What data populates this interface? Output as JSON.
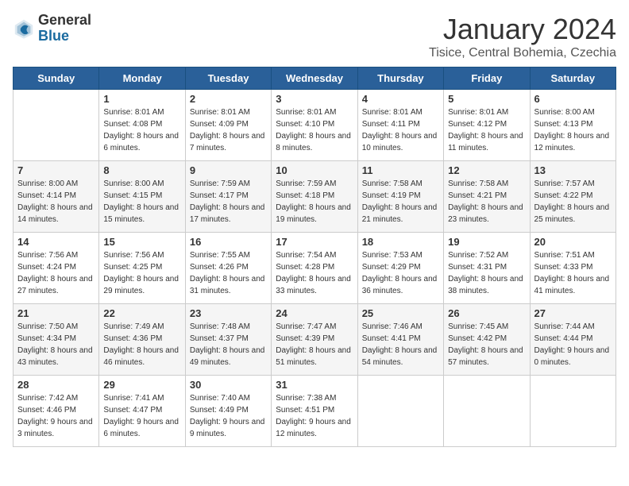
{
  "header": {
    "logo_general": "General",
    "logo_blue": "Blue",
    "month": "January 2024",
    "location": "Tisice, Central Bohemia, Czechia"
  },
  "days_of_week": [
    "Sunday",
    "Monday",
    "Tuesday",
    "Wednesday",
    "Thursday",
    "Friday",
    "Saturday"
  ],
  "weeks": [
    [
      {
        "day": "",
        "sunrise": "",
        "sunset": "",
        "daylight": ""
      },
      {
        "day": "1",
        "sunrise": "Sunrise: 8:01 AM",
        "sunset": "Sunset: 4:08 PM",
        "daylight": "Daylight: 8 hours and 6 minutes."
      },
      {
        "day": "2",
        "sunrise": "Sunrise: 8:01 AM",
        "sunset": "Sunset: 4:09 PM",
        "daylight": "Daylight: 8 hours and 7 minutes."
      },
      {
        "day": "3",
        "sunrise": "Sunrise: 8:01 AM",
        "sunset": "Sunset: 4:10 PM",
        "daylight": "Daylight: 8 hours and 8 minutes."
      },
      {
        "day": "4",
        "sunrise": "Sunrise: 8:01 AM",
        "sunset": "Sunset: 4:11 PM",
        "daylight": "Daylight: 8 hours and 10 minutes."
      },
      {
        "day": "5",
        "sunrise": "Sunrise: 8:01 AM",
        "sunset": "Sunset: 4:12 PM",
        "daylight": "Daylight: 8 hours and 11 minutes."
      },
      {
        "day": "6",
        "sunrise": "Sunrise: 8:00 AM",
        "sunset": "Sunset: 4:13 PM",
        "daylight": "Daylight: 8 hours and 12 minutes."
      }
    ],
    [
      {
        "day": "7",
        "sunrise": "Sunrise: 8:00 AM",
        "sunset": "Sunset: 4:14 PM",
        "daylight": "Daylight: 8 hours and 14 minutes."
      },
      {
        "day": "8",
        "sunrise": "Sunrise: 8:00 AM",
        "sunset": "Sunset: 4:15 PM",
        "daylight": "Daylight: 8 hours and 15 minutes."
      },
      {
        "day": "9",
        "sunrise": "Sunrise: 7:59 AM",
        "sunset": "Sunset: 4:17 PM",
        "daylight": "Daylight: 8 hours and 17 minutes."
      },
      {
        "day": "10",
        "sunrise": "Sunrise: 7:59 AM",
        "sunset": "Sunset: 4:18 PM",
        "daylight": "Daylight: 8 hours and 19 minutes."
      },
      {
        "day": "11",
        "sunrise": "Sunrise: 7:58 AM",
        "sunset": "Sunset: 4:19 PM",
        "daylight": "Daylight: 8 hours and 21 minutes."
      },
      {
        "day": "12",
        "sunrise": "Sunrise: 7:58 AM",
        "sunset": "Sunset: 4:21 PM",
        "daylight": "Daylight: 8 hours and 23 minutes."
      },
      {
        "day": "13",
        "sunrise": "Sunrise: 7:57 AM",
        "sunset": "Sunset: 4:22 PM",
        "daylight": "Daylight: 8 hours and 25 minutes."
      }
    ],
    [
      {
        "day": "14",
        "sunrise": "Sunrise: 7:56 AM",
        "sunset": "Sunset: 4:24 PM",
        "daylight": "Daylight: 8 hours and 27 minutes."
      },
      {
        "day": "15",
        "sunrise": "Sunrise: 7:56 AM",
        "sunset": "Sunset: 4:25 PM",
        "daylight": "Daylight: 8 hours and 29 minutes."
      },
      {
        "day": "16",
        "sunrise": "Sunrise: 7:55 AM",
        "sunset": "Sunset: 4:26 PM",
        "daylight": "Daylight: 8 hours and 31 minutes."
      },
      {
        "day": "17",
        "sunrise": "Sunrise: 7:54 AM",
        "sunset": "Sunset: 4:28 PM",
        "daylight": "Daylight: 8 hours and 33 minutes."
      },
      {
        "day": "18",
        "sunrise": "Sunrise: 7:53 AM",
        "sunset": "Sunset: 4:29 PM",
        "daylight": "Daylight: 8 hours and 36 minutes."
      },
      {
        "day": "19",
        "sunrise": "Sunrise: 7:52 AM",
        "sunset": "Sunset: 4:31 PM",
        "daylight": "Daylight: 8 hours and 38 minutes."
      },
      {
        "day": "20",
        "sunrise": "Sunrise: 7:51 AM",
        "sunset": "Sunset: 4:33 PM",
        "daylight": "Daylight: 8 hours and 41 minutes."
      }
    ],
    [
      {
        "day": "21",
        "sunrise": "Sunrise: 7:50 AM",
        "sunset": "Sunset: 4:34 PM",
        "daylight": "Daylight: 8 hours and 43 minutes."
      },
      {
        "day": "22",
        "sunrise": "Sunrise: 7:49 AM",
        "sunset": "Sunset: 4:36 PM",
        "daylight": "Daylight: 8 hours and 46 minutes."
      },
      {
        "day": "23",
        "sunrise": "Sunrise: 7:48 AM",
        "sunset": "Sunset: 4:37 PM",
        "daylight": "Daylight: 8 hours and 49 minutes."
      },
      {
        "day": "24",
        "sunrise": "Sunrise: 7:47 AM",
        "sunset": "Sunset: 4:39 PM",
        "daylight": "Daylight: 8 hours and 51 minutes."
      },
      {
        "day": "25",
        "sunrise": "Sunrise: 7:46 AM",
        "sunset": "Sunset: 4:41 PM",
        "daylight": "Daylight: 8 hours and 54 minutes."
      },
      {
        "day": "26",
        "sunrise": "Sunrise: 7:45 AM",
        "sunset": "Sunset: 4:42 PM",
        "daylight": "Daylight: 8 hours and 57 minutes."
      },
      {
        "day": "27",
        "sunrise": "Sunrise: 7:44 AM",
        "sunset": "Sunset: 4:44 PM",
        "daylight": "Daylight: 9 hours and 0 minutes."
      }
    ],
    [
      {
        "day": "28",
        "sunrise": "Sunrise: 7:42 AM",
        "sunset": "Sunset: 4:46 PM",
        "daylight": "Daylight: 9 hours and 3 minutes."
      },
      {
        "day": "29",
        "sunrise": "Sunrise: 7:41 AM",
        "sunset": "Sunset: 4:47 PM",
        "daylight": "Daylight: 9 hours and 6 minutes."
      },
      {
        "day": "30",
        "sunrise": "Sunrise: 7:40 AM",
        "sunset": "Sunset: 4:49 PM",
        "daylight": "Daylight: 9 hours and 9 minutes."
      },
      {
        "day": "31",
        "sunrise": "Sunrise: 7:38 AM",
        "sunset": "Sunset: 4:51 PM",
        "daylight": "Daylight: 9 hours and 12 minutes."
      },
      {
        "day": "",
        "sunrise": "",
        "sunset": "",
        "daylight": ""
      },
      {
        "day": "",
        "sunrise": "",
        "sunset": "",
        "daylight": ""
      },
      {
        "day": "",
        "sunrise": "",
        "sunset": "",
        "daylight": ""
      }
    ]
  ]
}
